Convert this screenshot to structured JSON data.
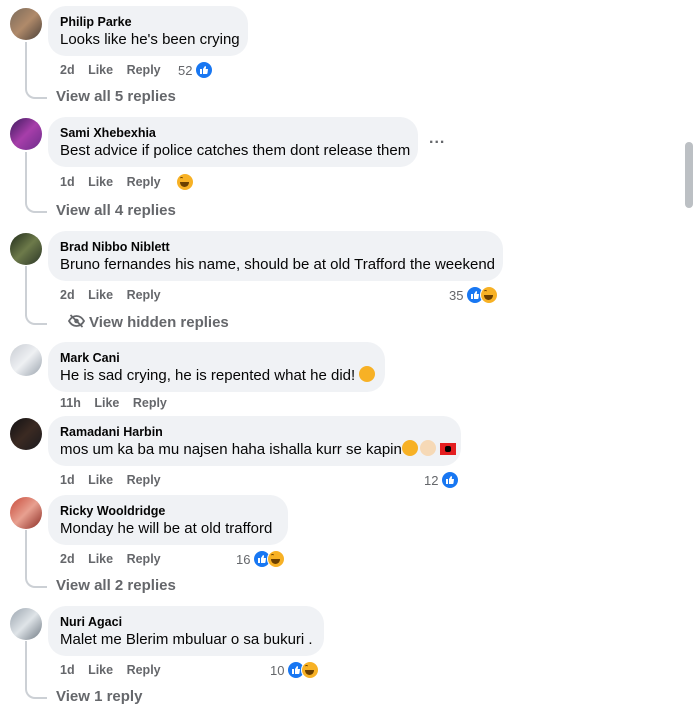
{
  "comments": [
    {
      "name": "Philip Parke",
      "text": "Looks like he's been crying",
      "time": "2d",
      "like": "Like",
      "reply": "Reply",
      "count": "52",
      "reactions": [
        "like"
      ],
      "view_replies": "View all 5 replies"
    },
    {
      "name": "Sami Xhebexhia",
      "text": "Best advice if police catches them dont release them",
      "time": "1d",
      "like": "Like",
      "reply": "Reply",
      "count": "",
      "reactions": [
        "haha"
      ],
      "view_replies": "View all 4 replies"
    },
    {
      "name": "Brad Nibbo Niblett",
      "text": "Bruno fernandes his name, should be at old Trafford the weekend",
      "time": "2d",
      "like": "Like",
      "reply": "Reply",
      "count": "35",
      "reactions": [
        "like",
        "haha"
      ],
      "view_replies": "View hidden replies"
    },
    {
      "name": "Mark Cani",
      "text": "He is sad crying, he is repented what he did!",
      "time": "11h",
      "like": "Like",
      "reply": "Reply",
      "count": "",
      "reactions": [],
      "view_replies": ""
    },
    {
      "name": "Ramadani Harbin",
      "text": "mos um ka ba mu najsen haha ishalla kurr se kapin",
      "time": "1d",
      "like": "Like",
      "reply": "Reply",
      "count": "12",
      "reactions": [
        "like"
      ],
      "view_replies": ""
    },
    {
      "name": "Ricky Wooldridge",
      "text": "Monday he will be at old trafford",
      "time": "2d",
      "like": "Like",
      "reply": "Reply",
      "count": "16",
      "reactions": [
        "like",
        "haha"
      ],
      "view_replies": "View all 2 replies"
    },
    {
      "name": "Nuri Agaci",
      "text": "Malet me Blerim mbuluar o sa bukuri .",
      "time": "1d",
      "like": "Like",
      "reply": "Reply",
      "count": "10",
      "reactions": [
        "like",
        "haha"
      ],
      "view_replies": "View 1 reply"
    }
  ],
  "more_options": "...",
  "colors": {
    "bubble": "#f0f2f5",
    "secondary_text": "#65676b",
    "like_blue": "#1877f2",
    "thread_line": "#ccd0d5"
  }
}
